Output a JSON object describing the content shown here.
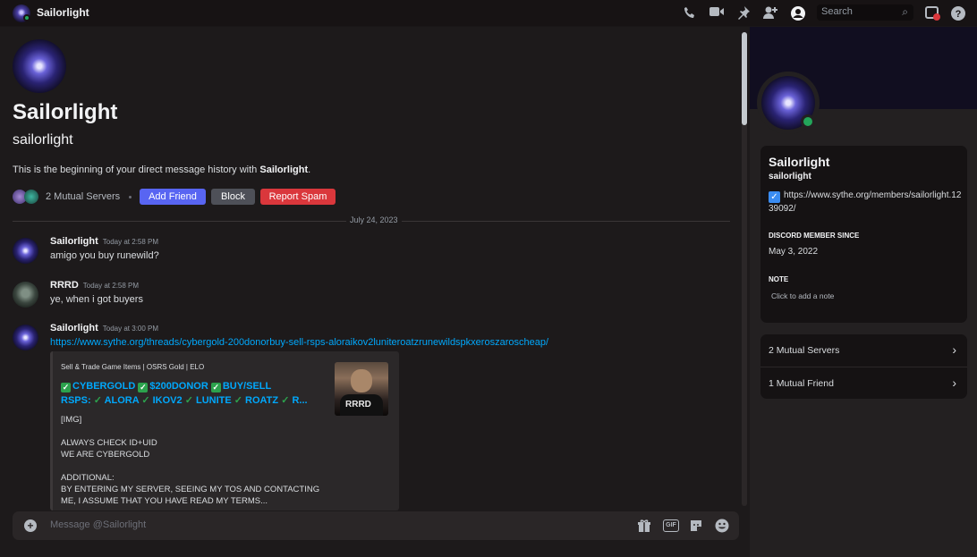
{
  "topbar": {
    "title": "Sailorlight",
    "search_placeholder": "Search",
    "icons": [
      "call-icon",
      "video-icon",
      "pin-icon",
      "add-member-icon",
      "profile-toggle-icon",
      "search-icon",
      "inbox-icon",
      "help-icon"
    ]
  },
  "header": {
    "display_name": "Sailorlight",
    "username": "sailorlight",
    "intro_prefix": "This is the beginning of your direct message history with ",
    "intro_name": "Sailorlight",
    "intro_suffix": ".",
    "mutual_servers": "2 Mutual Servers",
    "add_friend": "Add Friend",
    "block": "Block",
    "report_spam": "Report Spam"
  },
  "date_divider": "July 24, 2023",
  "messages": [
    {
      "author": "Sailorlight",
      "time": "Today at 2:58 PM",
      "text": "amigo you buy runewild?"
    },
    {
      "author": "RRRD",
      "time": "Today at 2:58 PM",
      "text": "ye, when i got buyers"
    },
    {
      "author": "Sailorlight",
      "time": "Today at 3:00 PM",
      "text": "https://www.sythe.org/threads/cybergold-200donorbuy-sell-rsps-aloraikov2luniteroatzrunewildspkxeroszaroscheap/"
    }
  ],
  "embed": {
    "provider": "Sell & Trade Game Items | OSRS Gold | ELO",
    "title_line1": [
      "CYBERGOLD",
      "$200DONOR",
      "BUY/SELL"
    ],
    "title_line2_prefix": "RSPS:",
    "title_line2": [
      "ALORA",
      "IKOV2",
      "LUNITE",
      "ROATZ",
      "R..."
    ],
    "description": "[IMG]\n\nALWAYS CHECK ID+UID\nWE ARE CYBERGOLD\n\nADDITIONAL:\nBY ENTERING MY SERVER, SEEING MY TOS AND CONTACTING\nME, I ASSUME THAT YOU HAVE READ MY TERMS...",
    "thumb_text": "RRRD"
  },
  "composer": {
    "placeholder": "Message @Sailorlight"
  },
  "profile": {
    "display_name": "Sailorlight",
    "username": "sailorlight",
    "bio": "https://www.sythe.org/members/sailorlight.1239092/",
    "member_since_label": "DISCORD MEMBER SINCE",
    "member_since": "May 3, 2022",
    "note_label": "NOTE",
    "note_placeholder": "Click to add a note",
    "mutual_servers": "2 Mutual Servers",
    "mutual_friends": "1 Mutual Friend"
  },
  "colors": {
    "accent": "#5865f2",
    "danger": "#da373c",
    "online": "#23a55a",
    "link": "#00a8fc",
    "check": "#2ca24d"
  }
}
